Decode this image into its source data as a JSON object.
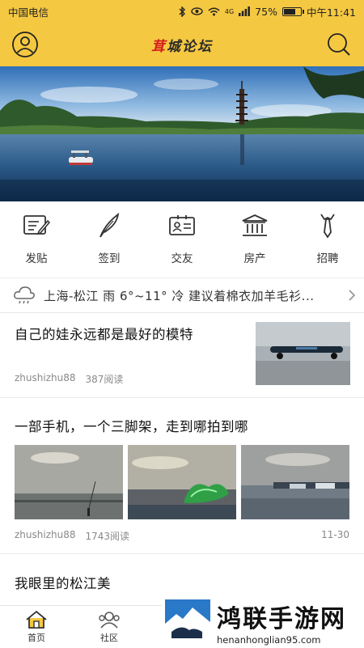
{
  "status": {
    "carrier": "中国电信",
    "network": "4G",
    "battery": "75%",
    "battery_level": 0.75,
    "time": "中午11:41"
  },
  "header": {
    "logo_accent": "茸",
    "logo_rest": "城论坛",
    "profile_icon": "user-icon",
    "search_icon": "search-icon"
  },
  "quick_links": [
    {
      "label": "发贴",
      "icon": "post-icon"
    },
    {
      "label": "签到",
      "icon": "quill-icon"
    },
    {
      "label": "交友",
      "icon": "id-card-icon"
    },
    {
      "label": "房产",
      "icon": "building-icon"
    },
    {
      "label": "招聘",
      "icon": "tie-icon"
    }
  ],
  "weather": {
    "text": "上海-松江 雨 6°~11° 冷 建议着棉衣加羊毛衫..."
  },
  "posts": [
    {
      "title": "自己的娃永远都是最好的模特",
      "author": "zhushizhu88",
      "reads": "387阅读"
    },
    {
      "title": "一部手机，一个三脚架，走到哪拍到哪",
      "author": "zhushizhu88",
      "reads": "1743阅读",
      "date": "11-30"
    },
    {
      "title": "我眼里的松江美"
    }
  ],
  "tabs": [
    {
      "label": "首页",
      "icon": "home-icon"
    },
    {
      "label": "社区",
      "icon": "community-icon"
    }
  ],
  "watermark": {
    "name": "鸿联手游网",
    "url": "henanhonglian95.com"
  },
  "colors": {
    "brand_yellow": "#f5c842",
    "logo_red": "#d31c1c"
  }
}
